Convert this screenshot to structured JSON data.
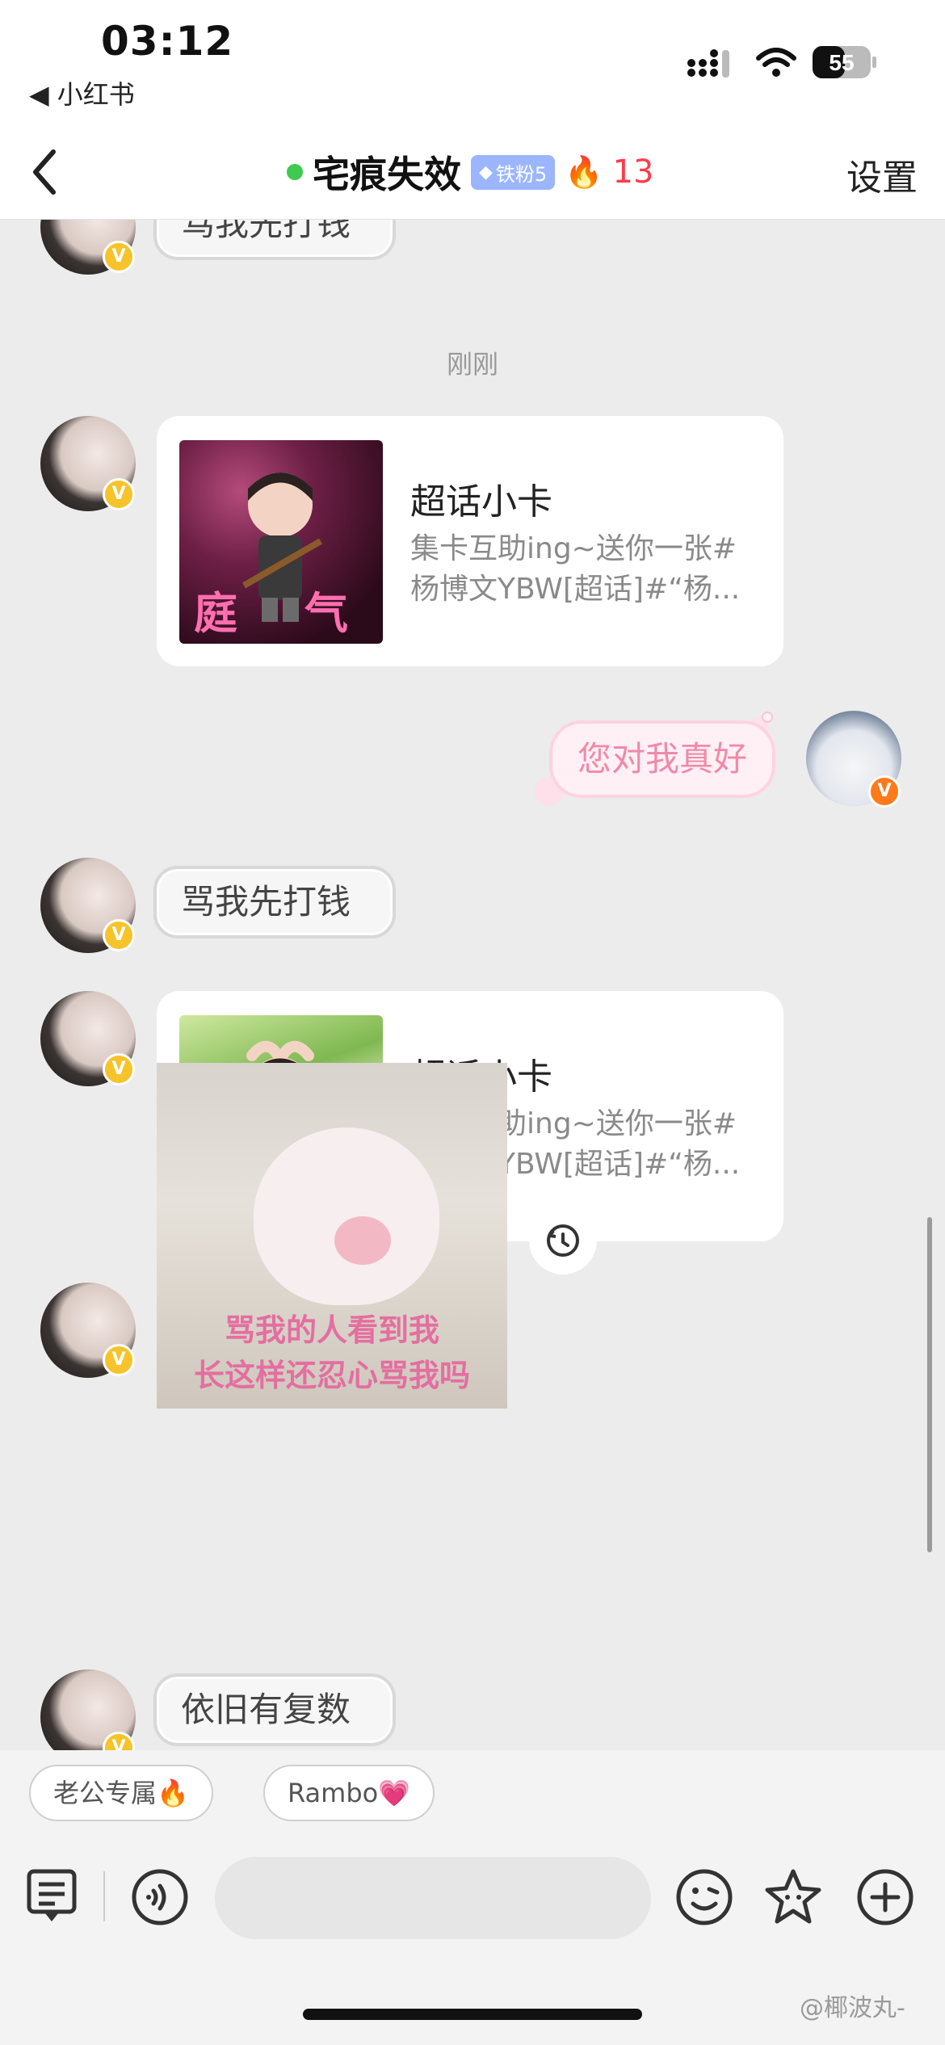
{
  "status_bar": {
    "time": "03:12",
    "back_app": "◀ 小红书",
    "battery": "55"
  },
  "nav": {
    "title": "宅痕失效",
    "fan_badge": "铁粉5",
    "streak": "13",
    "settings": "设置"
  },
  "chat": {
    "top_partial_bubble": "骂我先打钱",
    "timestamp": "刚刚",
    "card1": {
      "title": "超话小卡",
      "desc": "集卡互助ing~送你一张#杨博文YBW[超话]#“杨...",
      "thumb_left": "庭",
      "thumb_right": "气"
    },
    "my_message": "您对我真好",
    "bubble2": "骂我先打钱",
    "card2": {
      "title": "超话小卡",
      "desc": "集卡互助ing~送你一张#杨博文YBW[超话]#“杨..."
    },
    "pig_caption_1": "骂我的人看到我",
    "pig_caption_2": "长这样还忍心骂我吗",
    "bubble3": "依旧有复数"
  },
  "quick_replies": [
    {
      "label": "老公专属🔥"
    },
    {
      "label": "Rambo💗"
    }
  ],
  "watermark": "@椰波丸-",
  "colors": {
    "online": "#3fca4f",
    "streak": "#ff3a4c",
    "verify_badge": "#f6c32a"
  }
}
